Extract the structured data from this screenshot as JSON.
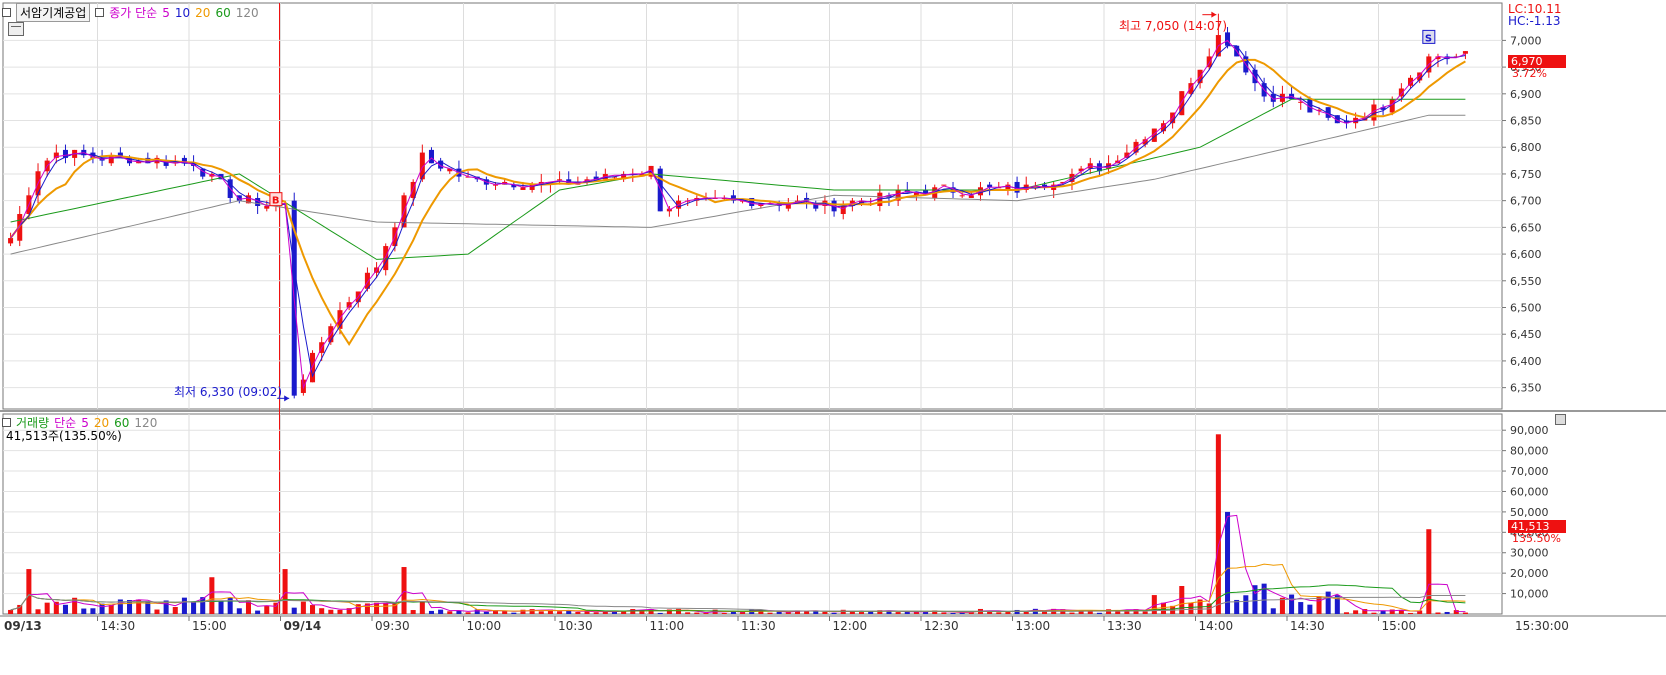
{
  "price_panel": {
    "symbol": "서암기계공업",
    "ma_label": "종가 단순",
    "ma_periods": [
      "5",
      "10",
      "20",
      "60",
      "120"
    ],
    "ma_colors": {
      "5": "#cc00cc",
      "10": "#1a1acc",
      "20": "#ee9900",
      "60": "#1a9a1a",
      "120": "#888888"
    },
    "y_ticks": [
      "7,000",
      "6,950",
      "6,900",
      "6,850",
      "6,800",
      "6,750",
      "6,700",
      "6,650",
      "6,600",
      "6,550",
      "6,500",
      "6,450",
      "6,400",
      "6,350"
    ],
    "lc_text": "LC:10.11",
    "hc_text": "HC:-1.13",
    "current_price": "6,970",
    "change_pct": "3.72%",
    "high_note": "최고 7,050 (14:07)",
    "low_note": "최저 6,330 (09:02)",
    "buy_marker": "B",
    "sell_marker": "S"
  },
  "volume_panel": {
    "label": "거래량",
    "ma_label": "단순",
    "ma_periods": [
      "5",
      "20",
      "60",
      "120"
    ],
    "value_text": "41,513주(135.50%)",
    "y_ticks": [
      "90,000",
      "80,000",
      "70,000",
      "60,000",
      "50,000",
      "40,000",
      "30,000",
      "20,000",
      "10,000"
    ],
    "current_volume": "41,513",
    "current_pct": "135.50%"
  },
  "x_axis": {
    "labels": [
      "09/13",
      "14:30",
      "15:00",
      "09/14",
      "09:30",
      "10:00",
      "10:30",
      "11:00",
      "11:30",
      "12:00",
      "12:30",
      "13:00",
      "13:30",
      "14:00",
      "14:30",
      "15:00",
      "15:30:00"
    ]
  },
  "chart_data": {
    "type": "candlestick",
    "title": "서암기계공업",
    "interval_minutes": 3,
    "sessions": [
      "09/13 14:00-15:30",
      "09/14 09:00-15:30"
    ],
    "ylim_price": [
      6310,
      7070
    ],
    "ylim_volume": [
      0,
      95000
    ],
    "close_keypoints": [
      {
        "t": "09/13 14:00",
        "close": 6630
      },
      {
        "t": "09/13 14:09",
        "close": 6760
      },
      {
        "t": "09/13 14:15",
        "close": 6790
      },
      {
        "t": "09/13 14:30",
        "close": 6780
      },
      {
        "t": "09/13 15:00",
        "close": 6770
      },
      {
        "t": "09/13 15:15",
        "close": 6700
      },
      {
        "t": "09/13 15:30",
        "close": 6690
      },
      {
        "t": "09/14 09:02",
        "close": 6330
      },
      {
        "t": "09/14 09:15",
        "close": 6470
      },
      {
        "t": "09/14 09:30",
        "close": 6580
      },
      {
        "t": "09/14 09:45",
        "close": 6780
      },
      {
        "t": "09/14 10:00",
        "close": 6740
      },
      {
        "t": "09/14 10:30",
        "close": 6730
      },
      {
        "t": "09/14 11:00",
        "close": 6760
      },
      {
        "t": "09/14 11:02",
        "close": 6690
      },
      {
        "t": "09/14 11:30",
        "close": 6700
      },
      {
        "t": "09/14 12:00",
        "close": 6690
      },
      {
        "t": "09/14 12:30",
        "close": 6720
      },
      {
        "t": "09/14 13:00",
        "close": 6720
      },
      {
        "t": "09/14 13:30",
        "close": 6770
      },
      {
        "t": "09/14 13:50",
        "close": 6860
      },
      {
        "t": "09/14 14:07",
        "close": 7020
      },
      {
        "t": "09/14 14:20",
        "close": 6900
      },
      {
        "t": "09/14 14:30",
        "close": 6890
      },
      {
        "t": "09/14 14:45",
        "close": 6840
      },
      {
        "t": "09/14 15:00",
        "close": 6880
      },
      {
        "t": "09/14 15:15",
        "close": 6970
      }
    ],
    "high": {
      "price": 7050,
      "time": "14:07"
    },
    "low": {
      "price": 6330,
      "time": "09:02"
    },
    "ma60_keypoints": [
      {
        "t": "09/13 14:00",
        "v": 6660
      },
      {
        "t": "09/13 15:15",
        "v": 6750
      },
      {
        "t": "09/14 09:30",
        "v": 6590
      },
      {
        "t": "09/14 10:00",
        "v": 6600
      },
      {
        "t": "09/14 10:30",
        "v": 6720
      },
      {
        "t": "09/14 11:00",
        "v": 6750
      },
      {
        "t": "09/14 12:00",
        "v": 6720
      },
      {
        "t": "09/14 13:00",
        "v": 6720
      },
      {
        "t": "09/14 14:00",
        "v": 6800
      },
      {
        "t": "09/14 14:30",
        "v": 6890
      },
      {
        "t": "09/14 15:15",
        "v": 6890
      }
    ],
    "ma120_keypoints": [
      {
        "t": "09/13 14:00",
        "v": 6600
      },
      {
        "t": "09/13 15:15",
        "v": 6700
      },
      {
        "t": "09/14 09:30",
        "v": 6660
      },
      {
        "t": "09/14 11:00",
        "v": 6650
      },
      {
        "t": "09/14 12:00",
        "v": 6710
      },
      {
        "t": "09/14 13:00",
        "v": 6700
      },
      {
        "t": "09/14 13:45",
        "v": 6740
      },
      {
        "t": "09/14 14:30",
        "v": 6800
      },
      {
        "t": "09/14 15:15",
        "v": 6860
      }
    ],
    "volume_spikes": [
      {
        "t": "09/13 14:06",
        "v": 22000
      },
      {
        "t": "09/13 15:06",
        "v": 18000
      },
      {
        "t": "09/14 09:00",
        "v": 22000
      },
      {
        "t": "09/14 09:39",
        "v": 23000
      },
      {
        "t": "09/14 14:06",
        "v": 88000
      },
      {
        "t": "09/14 14:09",
        "v": 50000
      },
      {
        "t": "09/14 15:15",
        "v": 41513
      }
    ]
  }
}
